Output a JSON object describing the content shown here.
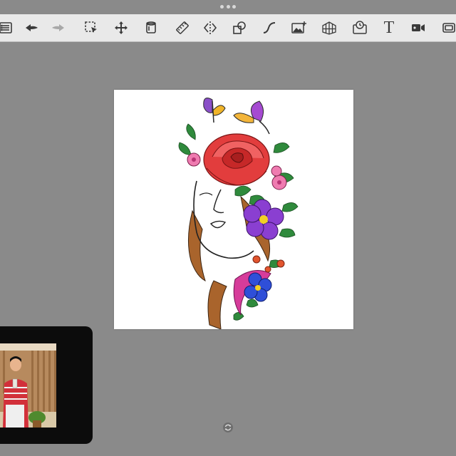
{
  "toolbar": {
    "tools": [
      {
        "name": "gallery-list-icon"
      },
      {
        "name": "undo-icon"
      },
      {
        "name": "redo-icon"
      },
      {
        "name": "selection-icon"
      },
      {
        "name": "transform-icon"
      },
      {
        "name": "fill-icon"
      },
      {
        "name": "ruler-icon"
      },
      {
        "name": "symmetry-icon"
      },
      {
        "name": "shapes-icon"
      },
      {
        "name": "curve-icon"
      },
      {
        "name": "import-image-icon"
      },
      {
        "name": "perspective-grid-icon"
      },
      {
        "name": "timelapse-icon"
      },
      {
        "name": "text-tool-icon",
        "label": "T"
      },
      {
        "name": "video-record-icon"
      },
      {
        "name": "fullscreen-icon"
      }
    ]
  },
  "colors": {
    "workspace": "#8a8a8a",
    "toolbar": "#e9e9e9",
    "icon": "#3a3a3a",
    "icon_disabled": "#a8a8a8",
    "rose": "#e23d3d",
    "violet": "#8a3fd1",
    "blue_flower": "#2f4fd8",
    "hair": "#a9642c",
    "leaf": "#2f8a3c"
  }
}
